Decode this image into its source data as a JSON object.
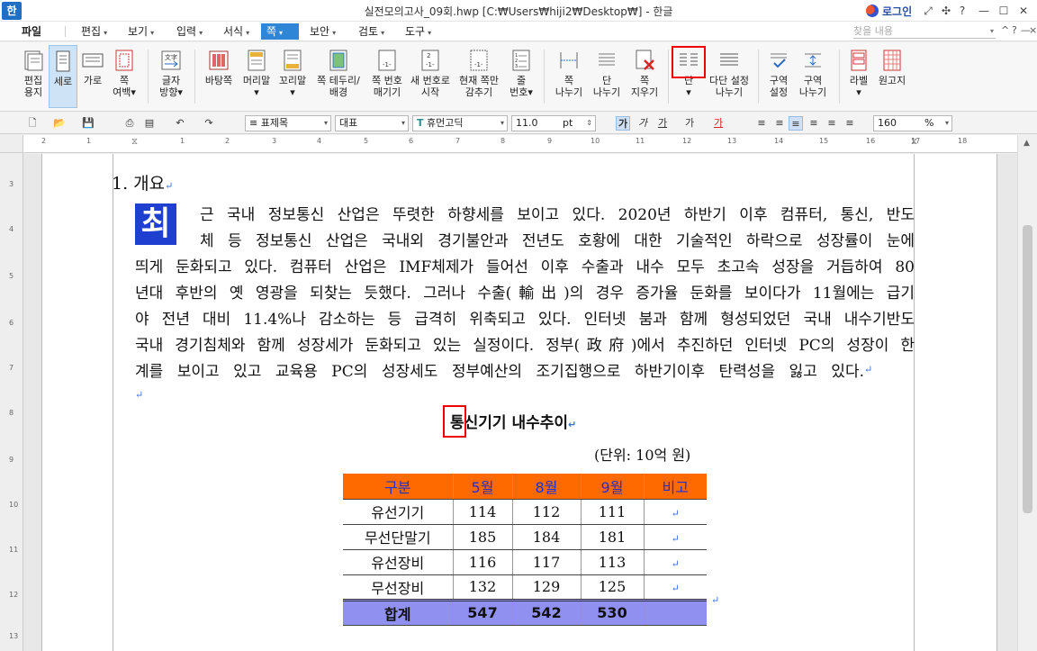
{
  "titlebar": {
    "app_logo": "한",
    "title": "실전모의고사_09회.hwp [C:₩Users₩hiji2₩Desktop₩] - 한글",
    "login": "로그인",
    "controls": [
      "⤢",
      "✣",
      "?",
      "—",
      "☐",
      "✕"
    ]
  },
  "menu": {
    "items": [
      "파일",
      "편집",
      "보기",
      "입력",
      "서식",
      "쪽",
      "보안",
      "검토",
      "도구"
    ],
    "active_index": 5,
    "search_placeholder": "찾을 내용",
    "right_controls": [
      "^",
      "?",
      "—",
      "×"
    ]
  },
  "ribbon": {
    "buttons": [
      {
        "label": "편집\n용지",
        "icon": "page-setup-icon"
      },
      {
        "label": "세로",
        "icon": "portrait-icon"
      },
      {
        "label": "가로",
        "icon": "landscape-icon"
      },
      {
        "label": "쪽\n여백▾",
        "icon": "margin-icon"
      },
      {
        "label": "글자\n방향▾",
        "icon": "text-direction-icon"
      },
      {
        "label": "바탕쪽",
        "icon": "master-page-icon"
      },
      {
        "label": "머리말\n▾",
        "icon": "header-icon"
      },
      {
        "label": "꼬리말\n▾",
        "icon": "footer-icon"
      },
      {
        "label": "쪽 테두리/\n배경",
        "icon": "page-border-icon"
      },
      {
        "label": "쪽 번호\n매기기",
        "icon": "page-number-icon"
      },
      {
        "label": "새 번호로\n시작",
        "icon": "new-number-icon"
      },
      {
        "label": "현재 쪽만\n감추기",
        "icon": "hide-page-icon"
      },
      {
        "label": "줄\n번호▾",
        "icon": "line-number-icon"
      },
      {
        "label": "쪽\n나누기",
        "icon": "page-break-icon"
      },
      {
        "label": "단\n나누기",
        "icon": "column-break-icon"
      },
      {
        "label": "쪽\n지우기",
        "icon": "delete-page-icon"
      },
      {
        "label": "단\n▾",
        "icon": "columns-icon"
      },
      {
        "label": "다단 설정\n나누기",
        "icon": "multi-column-icon"
      },
      {
        "label": "구역\n설정",
        "icon": "section-setup-icon"
      },
      {
        "label": "구역\n나누기",
        "icon": "section-break-icon"
      },
      {
        "label": "라벨\n▾",
        "icon": "label-icon"
      },
      {
        "label": "원고지",
        "icon": "manuscript-icon"
      }
    ],
    "selected_index": 1
  },
  "format": {
    "style": "표제목",
    "language": "대표",
    "font": "휴먼고딕",
    "size": "11.0",
    "unit": "pt",
    "zoom": "160",
    "zoom_unit": "%",
    "font_icon": "T",
    "style_icon": "≡",
    "toggles": [
      "가",
      "가",
      "가",
      "가",
      "가"
    ]
  },
  "ruler": {
    "h_numbers": [
      "1",
      "2",
      "1",
      "2",
      "3",
      "4",
      "5",
      "6",
      "7",
      "8",
      "9",
      "10",
      "11",
      "12",
      "13",
      "14",
      "15",
      "16",
      "17",
      "18"
    ],
    "v_numbers": [
      "3",
      "4",
      "5",
      "6",
      "7",
      "8",
      "9",
      "10",
      "11",
      "12",
      "13"
    ]
  },
  "document": {
    "heading": "1. 개요",
    "dropcap": "최",
    "paragraph_lines": [
      "근 국내 정보통신 산업은 뚜렷한 하향세를 보이고 있다. 2020년 하반기 이후 컴퓨터, 통신, 반도",
      "체 등 정보통신 산업은 국내외 경기불안과 전년도 호황에 대한 기술적인 하락으로 성장률이 눈에",
      "띄게 둔화되고 있다. 컴퓨터 산업은 IMF체제가 들어선 이후 수출과 내수 모두 초고속 성장을 거듭하여 80",
      "년대 후반의 옛 영광을 되찾는 듯했다. 그러나 수출(輸出)의 경우 증가율 둔화를 보이다가 11월에는 급기",
      "야 전년 대비 11.4%나 감소하는 등 급격히 위축되고 있다. 인터넷 붐과 함께 형성되었던 국내 내수기반도",
      "국내 경기침체와 함께 성장세가 둔화되고 있는 실정이다. 정부(政府)에서 추진하던 인터넷 PC의 성장이 한",
      "계를 보이고 있고 교육용 PC의 성장세도 정부예산의 조기집행으로 하반기이후 탄력성을 잃고 있다."
    ],
    "table_caption": "통신기기 내수추이",
    "unit_note": "(단위: 10억 원)",
    "table": {
      "headers": [
        "구분",
        "5월",
        "8월",
        "9월",
        "비고"
      ],
      "rows": [
        [
          "유선기기",
          "114",
          "112",
          "111",
          ""
        ],
        [
          "무선단말기",
          "185",
          "184",
          "181",
          ""
        ],
        [
          "유선장비",
          "116",
          "117",
          "113",
          ""
        ],
        [
          "무선장비",
          "132",
          "129",
          "125",
          ""
        ]
      ],
      "total": [
        "합계",
        "547",
        "542",
        "530",
        ""
      ]
    },
    "paragraph_mark": "↵"
  },
  "colors": {
    "accent": "#2f86d7",
    "table_header_bg": "#ff6a00",
    "table_header_text": "#2030d0",
    "table_total_bg": "#9090f0",
    "dropcap_bg": "#1f3fd0",
    "highlight": "#e00000"
  }
}
